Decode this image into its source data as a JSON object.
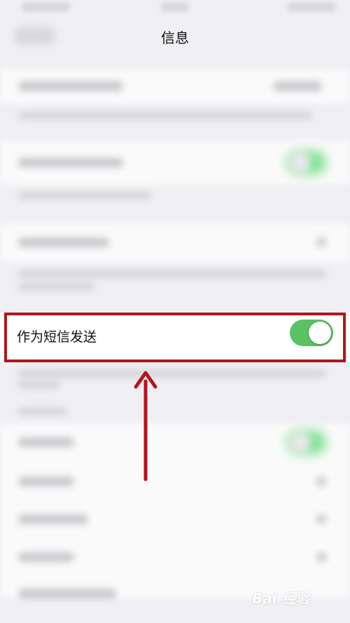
{
  "nav": {
    "title": "信息"
  },
  "setting": {
    "label": "作为短信发送",
    "enabled": true
  },
  "colors": {
    "toggle_on": "#5ac262",
    "highlight": "#b0161c",
    "background": "#efeff4"
  },
  "watermark": {
    "text": "Bai 经验",
    "icon": "baidu-paw-icon"
  }
}
